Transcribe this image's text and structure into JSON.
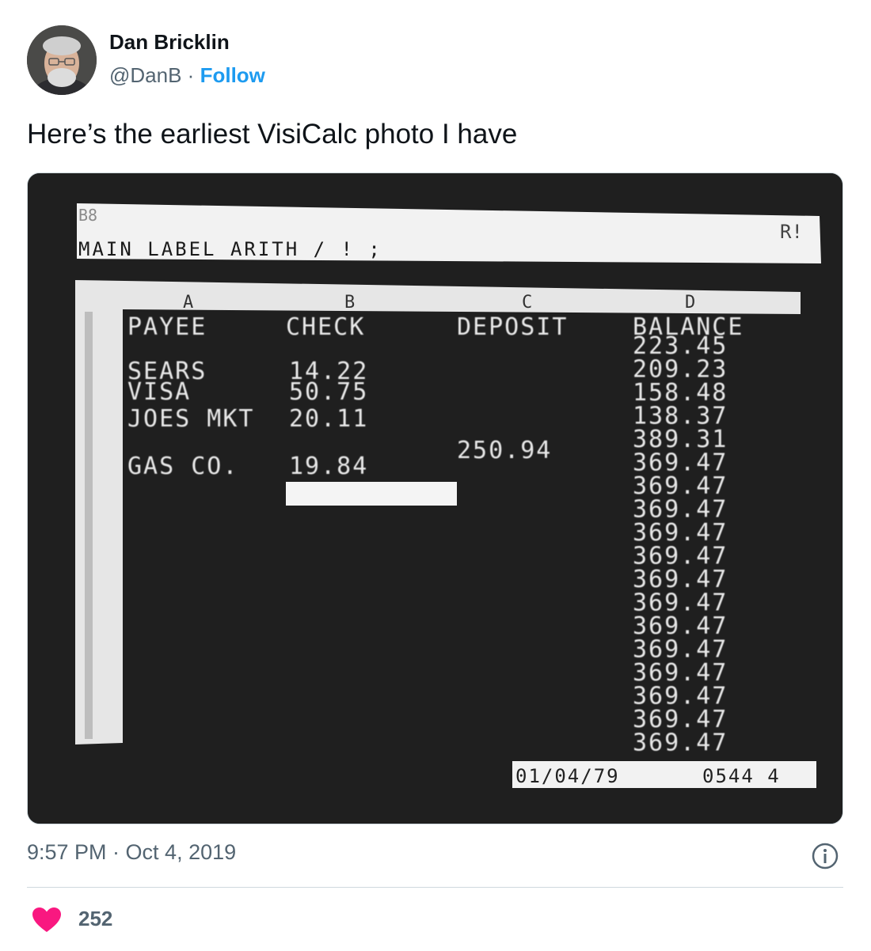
{
  "tweet": {
    "author_name": "Dan Bricklin",
    "handle": "@DanB",
    "separator": "·",
    "follow_label": "Follow",
    "text": "Here’s the earliest VisiCalc photo I have",
    "timestamp": "9:57 PM · Oct 4, 2019",
    "like_count": "252",
    "like_color": "#f91880",
    "link_color": "#1d9bf0"
  },
  "visicalc": {
    "cell_ref": "B8",
    "command_line": "MAIN LABEL ARITH / ! ;",
    "mode_indicator": "R!",
    "column_letters": [
      "A",
      "B",
      "C",
      "D"
    ],
    "headers": [
      "PAYEE",
      "CHECK",
      "DEPOSIT",
      "BALANCE"
    ],
    "payees": [
      "SEARS",
      "VISA",
      "JOES MKT",
      "GAS CO."
    ],
    "checks": [
      "14.22",
      "50.75",
      "20.11",
      "19.84"
    ],
    "deposit": "250.94",
    "balances": [
      "223.45",
      "209.23",
      "158.48",
      "138.37",
      "389.31",
      "369.47",
      "369.47",
      "369.47",
      "369.47",
      "369.47",
      "369.47",
      "369.47",
      "369.47",
      "369.47",
      "369.47",
      "369.47",
      "369.47",
      "369.47"
    ],
    "status_date": "01/04/79",
    "status_memory": "0544 4"
  }
}
